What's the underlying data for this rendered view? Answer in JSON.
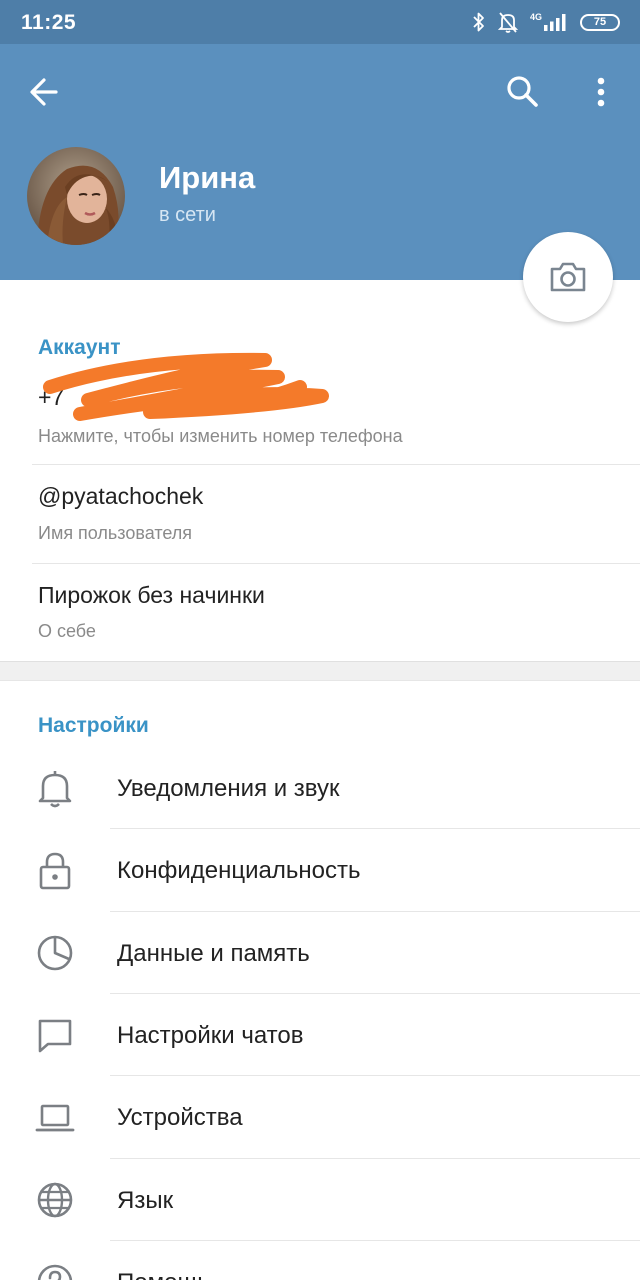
{
  "status_bar": {
    "time": "11:25",
    "network": "4G",
    "battery": "75",
    "icons": [
      "bluetooth-icon",
      "mute-bell-icon",
      "signal-icon",
      "battery-icon"
    ]
  },
  "header": {
    "name": "Ирина",
    "status": "в сети",
    "icons": [
      "back-arrow-icon",
      "search-icon",
      "more-vertical-icon",
      "camera-icon"
    ],
    "background_color": "#5b90be"
  },
  "account": {
    "title": "Аккаунт",
    "phone_label": "Нажмите, чтобы изменить номер телефона",
    "username": "@pyatachochek",
    "username_label": "Имя пользователя",
    "bio": "Пирожок без начинки",
    "bio_label": "О себе"
  },
  "settings": {
    "title": "Настройки",
    "items": [
      {
        "label": "Уведомления и звук",
        "icon": "bell-icon"
      },
      {
        "label": "Конфиденциальность",
        "icon": "lock-icon"
      },
      {
        "label": "Данные и память",
        "icon": "pie-chart-icon"
      },
      {
        "label": "Настройки чатов",
        "icon": "chat-bubble-icon"
      },
      {
        "label": "Устройства",
        "icon": "laptop-icon"
      },
      {
        "label": "Язык",
        "icon": "globe-icon"
      },
      {
        "label": "Помощь",
        "icon": "help-icon"
      }
    ]
  },
  "colors": {
    "accent": "#3a93c6",
    "status_bar": "#4e7ea8",
    "scribble": "#f47a2a"
  }
}
